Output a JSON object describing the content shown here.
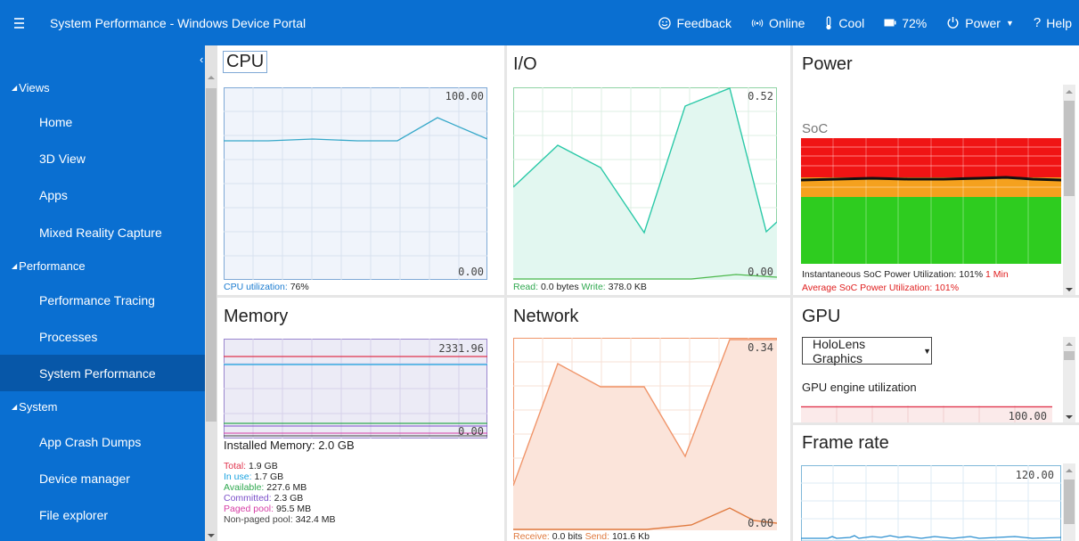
{
  "header": {
    "title": "System Performance - Windows Device Portal",
    "feedback": "Feedback",
    "online": "Online",
    "thermal": "Cool",
    "battery": "72%",
    "power": "Power",
    "help": "Help"
  },
  "sidebar": {
    "sections": [
      {
        "label": "Views",
        "items": [
          "Home",
          "3D View",
          "Apps",
          "Mixed Reality Capture"
        ]
      },
      {
        "label": "Performance",
        "items": [
          "Performance Tracing",
          "Processes",
          "System Performance"
        ]
      },
      {
        "label": "System",
        "items": [
          "App Crash Dumps",
          "Device manager",
          "File explorer"
        ]
      }
    ],
    "active": "System Performance"
  },
  "cpu": {
    "title": "CPU",
    "max": "100.00",
    "min": "0.00",
    "label": "CPU utilization:",
    "value": "76%"
  },
  "io": {
    "title": "I/O",
    "max": "0.52",
    "min": "0.00",
    "read_label": "Read:",
    "read_value": "0.0 bytes",
    "write_label": "Write:",
    "write_value": "378.0 KB"
  },
  "power": {
    "title": "Power",
    "soc_label": "SoC",
    "instantaneous": "Instantaneous SoC Power Utilization: 101%",
    "min_link": "1 Min",
    "average": "Average SoC Power Utilization: 101%"
  },
  "memory": {
    "title": "Memory",
    "max": "2331.96",
    "min": "0.00",
    "installed": "Installed Memory: 2.0 GB",
    "stats": [
      {
        "label": "Total:",
        "value": "1.9 GB",
        "color": "#e0334d"
      },
      {
        "label": "In use:",
        "value": "1.7 GB",
        "color": "#1aa3e0"
      },
      {
        "label": "Available:",
        "value": "227.6 MB",
        "color": "#2fa84f"
      },
      {
        "label": "Committed:",
        "value": "2.3 GB",
        "color": "#7b4fc9"
      },
      {
        "label": "Paged pool:",
        "value": "95.5 MB",
        "color": "#d63da5"
      },
      {
        "label": "Non-paged pool:",
        "value": "342.4 MB",
        "color": "#444444"
      }
    ]
  },
  "network": {
    "title": "Network",
    "max": "0.34",
    "min": "0.00",
    "receive_label": "Receive:",
    "receive_value": "0.0 bits",
    "send_label": "Send:",
    "send_value": "101.6 Kb"
  },
  "gpu": {
    "title": "GPU",
    "adapter": "HoloLens Graphics",
    "engine_label": "GPU engine utilization",
    "max": "100.00"
  },
  "framerate": {
    "title": "Frame rate",
    "max": "120.00"
  },
  "colors": {
    "accent": "#0a6fd1",
    "cpu": "#36a8c9",
    "io": "#2bc9a8",
    "network": "#f0956a",
    "red": "#e02020"
  }
}
